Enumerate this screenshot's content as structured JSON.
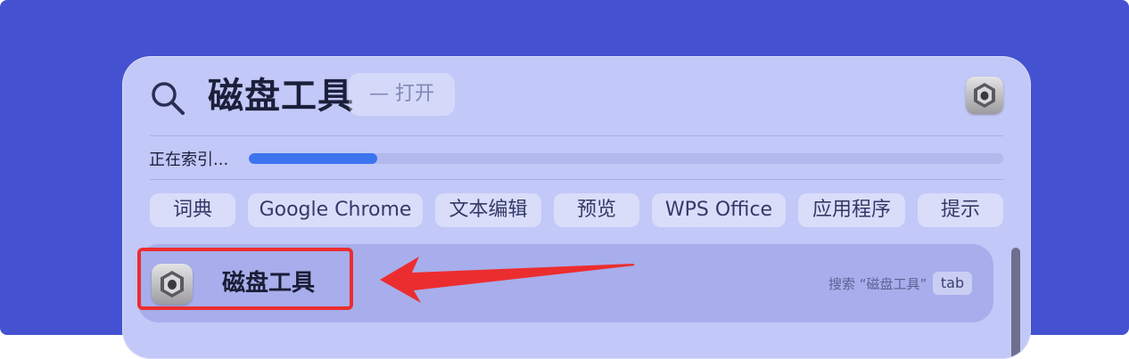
{
  "search": {
    "query": "磁盘工具",
    "hint": "— 打开",
    "icon": "magnifier-icon",
    "app_icon": "disk-utility-icon"
  },
  "indexing": {
    "label": "正在索引...",
    "progress": 0.17,
    "color": "#3b74ee"
  },
  "chips": [
    "词典",
    "Google Chrome",
    "文本编辑",
    "预览",
    "WPS Office",
    "应用程序",
    "提示"
  ],
  "result": {
    "title": "磁盘工具",
    "subtitle": "搜索 “磁盘工具”",
    "key": "tab",
    "icon": "disk-utility-icon"
  },
  "annotation": {
    "highlight_color": "#ec2d2f"
  }
}
